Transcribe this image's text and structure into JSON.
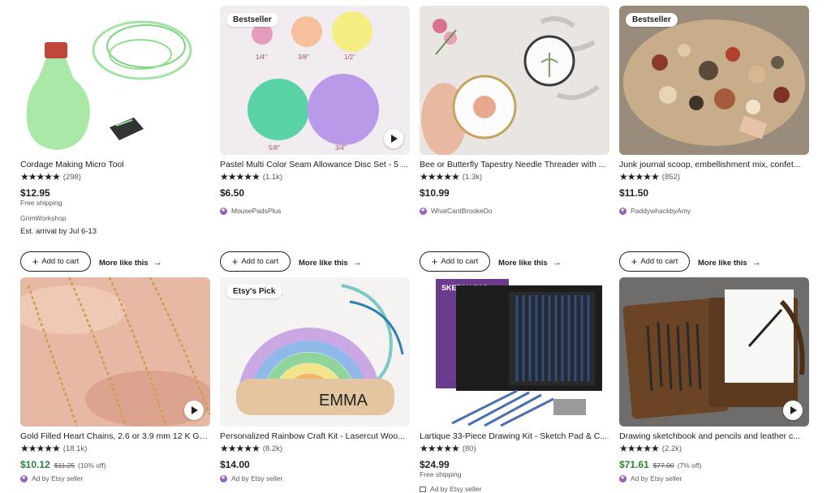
{
  "listings_row1": [
    {
      "title": "Cordage Making Micro Tool",
      "stars": "★★★★★",
      "count": "(298)",
      "price": "$12.95",
      "shipping": "Free shipping",
      "shop": "GrimWorkshop",
      "arrival": "Est. arrival by Jul 6-13",
      "cart_label": "Add to cart",
      "more_label": "More like this"
    },
    {
      "title": "Pastel Multi Color Seam Allowance Disc Set - 5 ...",
      "badge": "Bestseller",
      "stars": "★★★★★",
      "count": "(1.1k)",
      "price": "$6.50",
      "shop": "MousePadsPlus",
      "cart_label": "Add to cart",
      "more_label": "More like this"
    },
    {
      "title": "Bee or Butterfly Tapestry Needle Threader with ...",
      "stars": "★★★★★",
      "count": "(1.3k)",
      "price": "$10.99",
      "shop": "WhatCantBrookeDo",
      "cart_label": "Add to cart",
      "more_label": "More like this"
    },
    {
      "title": "Junk journal scoop, embellishment mix, confet...",
      "badge": "Bestseller",
      "stars": "★★★★★",
      "count": "(852)",
      "price": "$11.50",
      "shop": "PaddywhackbyAmy",
      "cart_label": "Add to cart",
      "more_label": "More like this"
    }
  ],
  "listings_row2": [
    {
      "title": "Gold Filled Heart Chains, 2.6 or 3.9 mm 12 K Go...",
      "stars": "★★★★★",
      "count": "(18.1k)",
      "price": "$10.12",
      "orig": "$11.25",
      "disc": "(10% off)",
      "ad": "Ad by Etsy seller"
    },
    {
      "title": "Personalized Rainbow Craft Kit - Lasercut Woo...",
      "badge": "Etsy's Pick",
      "stars": "★★★★★",
      "count": "(8.2k)",
      "price": "$14.00",
      "ad": "Ad by Etsy seller",
      "name_text": "EMMA"
    },
    {
      "title": "Lartique 33-Piece Drawing Kit - Sketch Pad & C...",
      "stars": "★★★★★",
      "count": "(80)",
      "price": "$24.99",
      "shipping": "Free shipping",
      "ad": "Ad by Etsy seller",
      "pad_text": "SKETCH PAD"
    },
    {
      "title": "Drawing sketchbook and pencils and leather c...",
      "stars": "★★★★★",
      "count": "(2.2k)",
      "price": "$71.61",
      "orig": "$77.00",
      "disc": "(7% off)",
      "ad": "Ad by Etsy seller"
    }
  ],
  "disc_labels": [
    "1/4\"",
    "3/8\"",
    "1/2\"",
    "5/8\"",
    "3/4\""
  ],
  "colors": {
    "sale_price": "#258635",
    "shop_icon": "#9560b8",
    "text": "#222222",
    "muted": "#595959"
  }
}
